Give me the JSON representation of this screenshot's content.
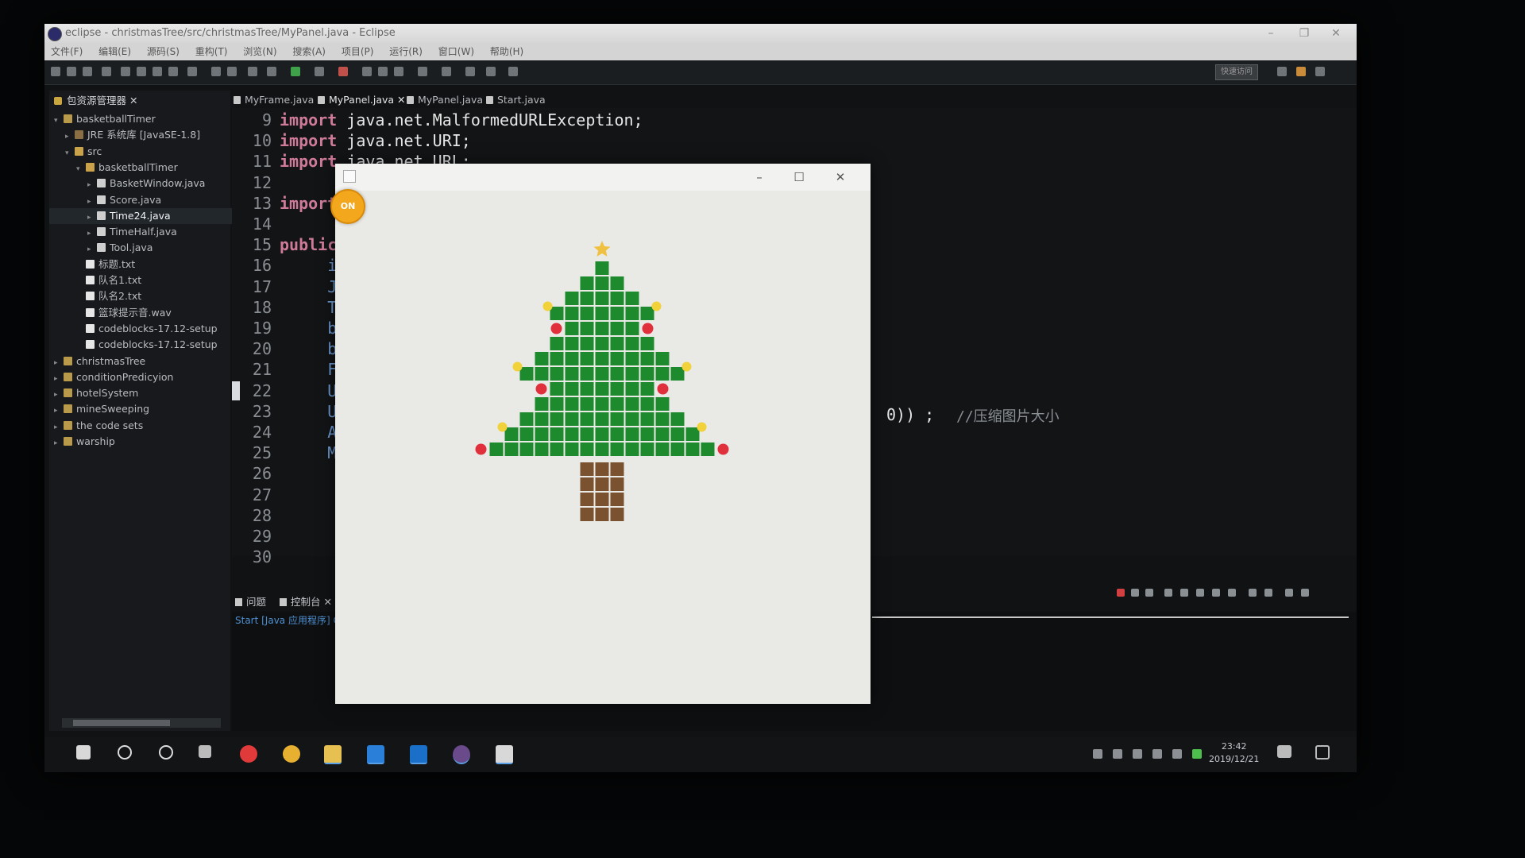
{
  "window": {
    "title": "eclipse - christmasTree/src/christmasTree/MyPanel.java - Eclipse",
    "controls": [
      "–",
      "❐",
      "✕"
    ]
  },
  "menu": [
    "文件(F)",
    "编辑(E)",
    "源码(S)",
    "重构(T)",
    "浏览(N)",
    "搜索(A)",
    "项目(P)",
    "运行(R)",
    "窗口(W)",
    "帮助(H)"
  ],
  "toolbar": {
    "quick_access": "快速访问"
  },
  "package_explorer": {
    "title": "包资源管理器 ✕",
    "items": [
      {
        "label": "basketballTimer",
        "indent": 0,
        "twisty": "▾",
        "icon": "project-folder-icon"
      },
      {
        "label": "JRE 系统库 [JavaSE-1.8]",
        "indent": 1,
        "twisty": "▸",
        "icon": "library-icon"
      },
      {
        "label": "src",
        "indent": 1,
        "twisty": "▾",
        "icon": "folder-icon"
      },
      {
        "label": "basketballTimer",
        "indent": 2,
        "twisty": "▾",
        "icon": "package-icon"
      },
      {
        "label": "BasketWindow.java",
        "indent": 3,
        "twisty": "▸",
        "icon": "java-file-icon"
      },
      {
        "label": "Score.java",
        "indent": 3,
        "twisty": "▸",
        "icon": "java-file-icon"
      },
      {
        "label": "Time24.java",
        "indent": 3,
        "twisty": "▸",
        "icon": "java-file-icon",
        "selected": true
      },
      {
        "label": "TimeHalf.java",
        "indent": 3,
        "twisty": "▸",
        "icon": "java-file-icon"
      },
      {
        "label": "Tool.java",
        "indent": 3,
        "twisty": "▸",
        "icon": "java-file-icon"
      },
      {
        "label": "标题.txt",
        "indent": 2,
        "twisty": "",
        "icon": "file-icon"
      },
      {
        "label": "队名1.txt",
        "indent": 2,
        "twisty": "",
        "icon": "file-icon"
      },
      {
        "label": "队名2.txt",
        "indent": 2,
        "twisty": "",
        "icon": "file-icon"
      },
      {
        "label": "篮球提示音.wav",
        "indent": 2,
        "twisty": "",
        "icon": "file-icon"
      },
      {
        "label": "codeblocks-17.12-setup",
        "indent": 2,
        "twisty": "",
        "icon": "file-icon"
      },
      {
        "label": "codeblocks-17.12-setup",
        "indent": 2,
        "twisty": "",
        "icon": "file-icon"
      },
      {
        "label": "christmasTree",
        "indent": 0,
        "twisty": "▸",
        "icon": "project-folder-icon"
      },
      {
        "label": "conditionPredicyion",
        "indent": 0,
        "twisty": "▸",
        "icon": "project-folder-icon"
      },
      {
        "label": "hotelSystem",
        "indent": 0,
        "twisty": "▸",
        "icon": "project-folder-icon"
      },
      {
        "label": "mineSweeping",
        "indent": 0,
        "twisty": "▸",
        "icon": "project-folder-icon"
      },
      {
        "label": "the code sets",
        "indent": 0,
        "twisty": "▸",
        "icon": "project-folder-icon"
      },
      {
        "label": "warship",
        "indent": 0,
        "twisty": "▸",
        "icon": "project-folder-icon"
      }
    ]
  },
  "editor_tabs": [
    {
      "label": "MyFrame.java"
    },
    {
      "label": "MyPanel.java ✕",
      "active": true
    },
    {
      "label": "MyPanel.java"
    },
    {
      "label": "Start.java"
    }
  ],
  "code_lines": [
    {
      "n": "9",
      "kw": "import",
      "rest": " java.net.MalformedURLException;"
    },
    {
      "n": "10",
      "kw": "import",
      "rest": " java.net.URI;"
    },
    {
      "n": "11",
      "kw": "import",
      "rest": " java.net.URL;"
    },
    {
      "n": "12",
      "kw": "",
      "rest": ""
    },
    {
      "n": "13",
      "kw": "import",
      "rest": ""
    },
    {
      "n": "14",
      "kw": "",
      "rest": ""
    },
    {
      "n": "15",
      "kw": "public",
      "rest": ""
    },
    {
      "n": "16",
      "kw": "",
      "rest": "     in"
    },
    {
      "n": "17",
      "kw": "",
      "rest": "     JB"
    },
    {
      "n": "18",
      "kw": "",
      "rest": "     Ti"
    },
    {
      "n": "19",
      "kw": "",
      "rest": "     bo"
    },
    {
      "n": "20",
      "kw": "",
      "rest": "     bo"
    },
    {
      "n": "21",
      "kw": "",
      "rest": "     Fi"
    },
    {
      "n": "22",
      "kw": "",
      "rest": "     UR"
    },
    {
      "n": "23",
      "kw": "",
      "rest": "     UR"
    },
    {
      "n": "24",
      "kw": "",
      "rest": "     Au"
    },
    {
      "n": "25",
      "kw": "",
      "rest": "     My"
    },
    {
      "n": "26",
      "kw": "",
      "rest": ""
    },
    {
      "n": "27",
      "kw": "",
      "rest": ""
    },
    {
      "n": "28",
      "kw": "",
      "rest": ""
    },
    {
      "n": "29",
      "kw": "",
      "rest": ""
    },
    {
      "n": "30",
      "kw": "",
      "rest": ""
    }
  ],
  "code_fragment": {
    "text": "0)) ;",
    "comment": "//压缩图片大小"
  },
  "bottom_views": {
    "tabs": [
      "问题",
      "控制台 ✕"
    ],
    "console_status": "Start [Java 应用程序] C"
  },
  "app_window": {
    "controls": [
      "–",
      "☐",
      "✕"
    ],
    "on_button": "ON",
    "tree_colors": {
      "leaf": "#1e8a2e",
      "trunk": "#7a5230",
      "red_ball": "#e0303c",
      "yellow_light": "#f2d23a",
      "star": "#f0c040",
      "background": "#e9e9e6"
    }
  },
  "taskbar": {
    "time": "23:42",
    "date": "2019/12/21"
  }
}
